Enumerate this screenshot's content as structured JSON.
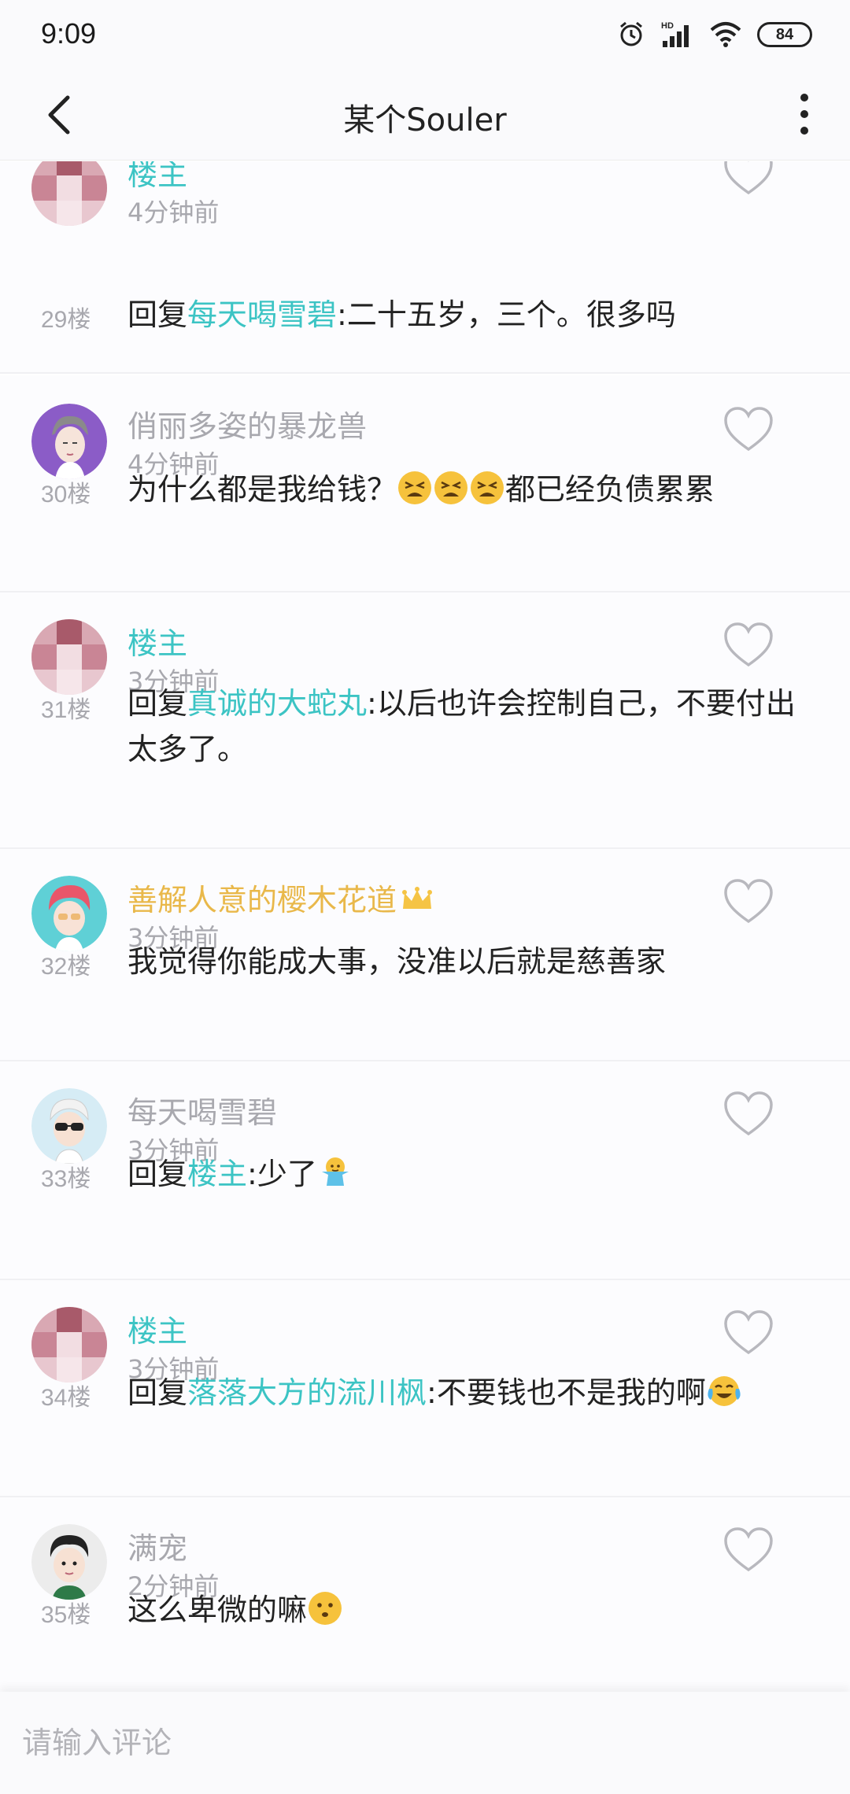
{
  "status_bar": {
    "time": "9:09",
    "battery": "84",
    "hd_label": "HD"
  },
  "header": {
    "title": "某个Souler"
  },
  "comments": [
    {
      "username": "楼主",
      "timestamp": "4分钟前",
      "floor": "29楼",
      "reply_prefix": "回复",
      "mention": "每天喝雪碧",
      "text": ":二十五岁，三个。很多吗"
    },
    {
      "username": "俏丽多姿的暴龙兽",
      "timestamp": "4分钟前",
      "floor": "30楼",
      "text_before": "为什么都是我给钱？",
      "emojis": [
        "tired-face-emoji",
        "tired-face-emoji",
        "tired-face-emoji"
      ],
      "text_after": "都已经负债累累"
    },
    {
      "username": "楼主",
      "timestamp": "3分钟前",
      "floor": "31楼",
      "reply_prefix": "回复",
      "mention": "真诚的大蛇丸",
      "text": ":以后也许会控制自己，不要付出太多了。"
    },
    {
      "username": "善解人意的樱木花道",
      "timestamp": "3分钟前",
      "floor": "32楼",
      "badge": "crown-icon",
      "text": "我觉得你能成大事，没准以后就是慈善家"
    },
    {
      "username": "每天喝雪碧",
      "timestamp": "3分钟前",
      "floor": "33楼",
      "reply_prefix": "回复",
      "mention": "楼主",
      "text": ":少了",
      "emoji": "shrug-emoji"
    },
    {
      "username": "楼主",
      "timestamp": "3分钟前",
      "floor": "34楼",
      "reply_prefix": "回复",
      "mention": "落落大方的流川枫",
      "text": ":不要钱也不是我的啊",
      "emoji": "tears-of-joy-emoji"
    },
    {
      "username": "满宠",
      "timestamp": "2分钟前",
      "floor": "35楼",
      "text": "这么卑微的嘛",
      "emoji": "hushed-face-emoji"
    }
  ],
  "input": {
    "placeholder": "请输入评论"
  },
  "colors": {
    "owner_name": "#3cc4c4",
    "mention": "#3cc4c4",
    "vip_name": "#e9b84a",
    "muted": "#a8a8ae"
  }
}
